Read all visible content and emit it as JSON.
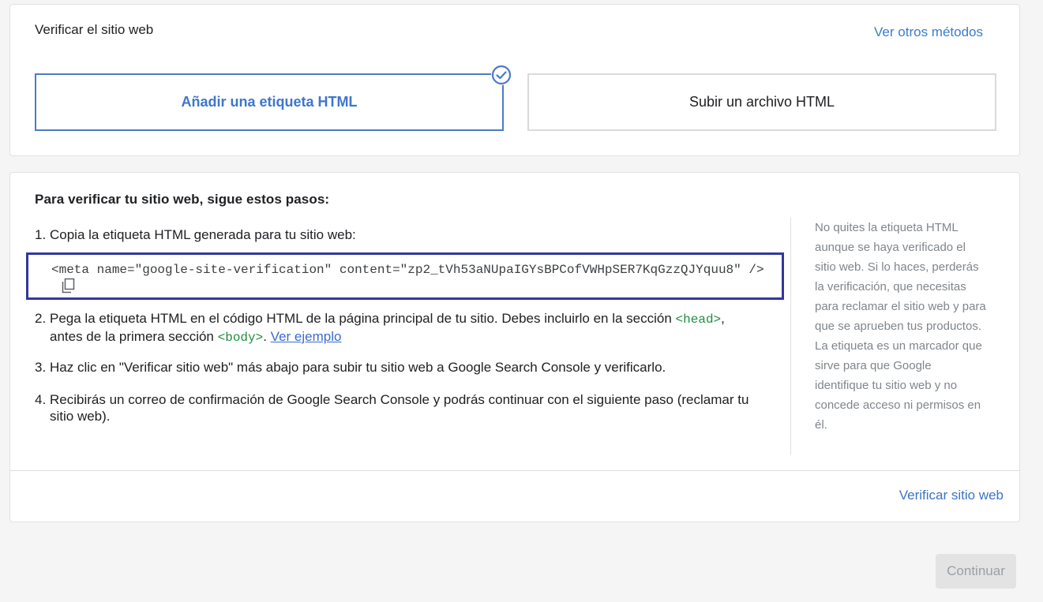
{
  "top": {
    "title": "Verificar el sitio web",
    "other_methods": "Ver otros métodos",
    "method_html_tag": "Añadir una etiqueta HTML",
    "method_html_file": "Subir un archivo HTML",
    "selected_icon": "check-circle-icon"
  },
  "main": {
    "title": "Para verificar tu sitio web, sigue estos pasos:",
    "step1": {
      "num": "1.",
      "text": "Copia la etiqueta HTML generada para tu sitio web:"
    },
    "meta_tag": "<meta name=\"google-site-verification\" content=\"zp2_tVh53aNUpaIGYsBPCofVWHpSER7KqGzzQJYquu8\" />",
    "copy_icon": "copy-icon",
    "step2": {
      "num": "2.",
      "text_a": "Pega la etiqueta HTML en el código HTML de la página principal de tu sitio. Debes incluirlo en la sección ",
      "code_head": "<head>",
      "text_b": ",",
      "text_c": "antes de la primera sección ",
      "code_body": "<body>",
      "text_d": ". ",
      "link": "Ver ejemplo"
    },
    "step3": {
      "num": "3.",
      "text": "Haz clic en \"Verificar sitio web\" más abajo para subir tu sitio web a Google Search Console y verificarlo."
    },
    "step4": {
      "num": "4.",
      "text": "Recibirás un correo de confirmación de Google Search Console y podrás continuar con el siguiente paso (reclamar tu sitio web)."
    },
    "side_note": "No quites la etiqueta HTML aunque se haya verificado el sitio web. Si lo haces, perderás la verificación, que necesitas para reclamar el sitio web y para que se aprueben tus productos. La etiqueta es un marcador que sirve para que Google identifique tu sitio web y no concede acceso ni permisos en él.",
    "verify_button": "Verificar sitio web"
  },
  "footer": {
    "continue_button": "Continuar"
  },
  "colors": {
    "accent": "#3e76cd",
    "highlight_box": "#3436a0",
    "code_green": "#1e8e3e"
  }
}
